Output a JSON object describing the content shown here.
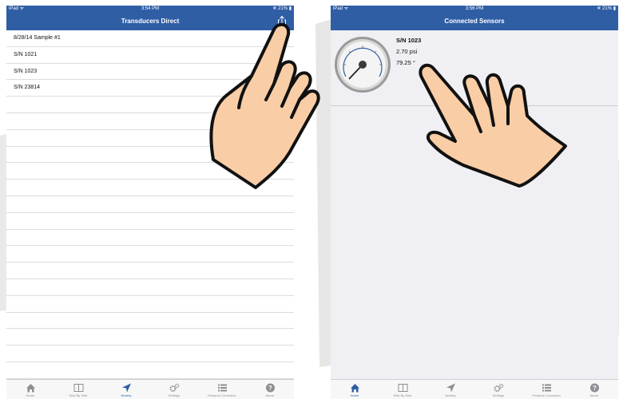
{
  "left": {
    "status": {
      "carrier": "iPad ᯤ",
      "time": "3:54 PM",
      "battery": "✵ 21% ▮"
    },
    "nav_title": "Transducers Direct",
    "rows": [
      "8/28/14 Sample #1",
      "S/N 1021",
      "S/N 1023",
      "S/N 23814",
      "",
      "",
      "",
      "",
      "",
      "",
      "",
      "",
      "",
      "",
      "",
      "",
      "",
      "",
      "",
      "",
      ""
    ],
    "tabs": [
      {
        "label": "Home",
        "icon": "home-icon"
      },
      {
        "label": "Side By Side",
        "icon": "side-by-side-icon"
      },
      {
        "label": "Nearby",
        "icon": "location-arrow-icon"
      },
      {
        "label": "Settings",
        "icon": "gears-icon"
      },
      {
        "label": "Pressure Correction",
        "icon": "list-icon"
      },
      {
        "label": "About",
        "icon": "help-icon"
      }
    ],
    "active_tab": "Nearby"
  },
  "right": {
    "status": {
      "carrier": "iPad ᯤ",
      "time": "3:56 PM",
      "battery": "✵ 21% ▮"
    },
    "nav_title": "Connected Sensors",
    "sensor": {
      "serial": "S/N 1023",
      "pressure": "2.70 psi",
      "temperature": "79.25 °"
    },
    "tabs": [
      {
        "label": "Home",
        "icon": "home-icon"
      },
      {
        "label": "Side By Side",
        "icon": "side-by-side-icon"
      },
      {
        "label": "Nearby",
        "icon": "location-arrow-icon"
      },
      {
        "label": "Settings",
        "icon": "gears-icon"
      },
      {
        "label": "Pressure Correction",
        "icon": "list-icon"
      },
      {
        "label": "About",
        "icon": "help-icon"
      }
    ],
    "active_tab": "Home"
  },
  "colors": {
    "nav": "#2f5ea5",
    "active": "#2f5ea5",
    "inactive": "#8e8e93",
    "hand": "#f9cda5",
    "outline": "#111111"
  }
}
